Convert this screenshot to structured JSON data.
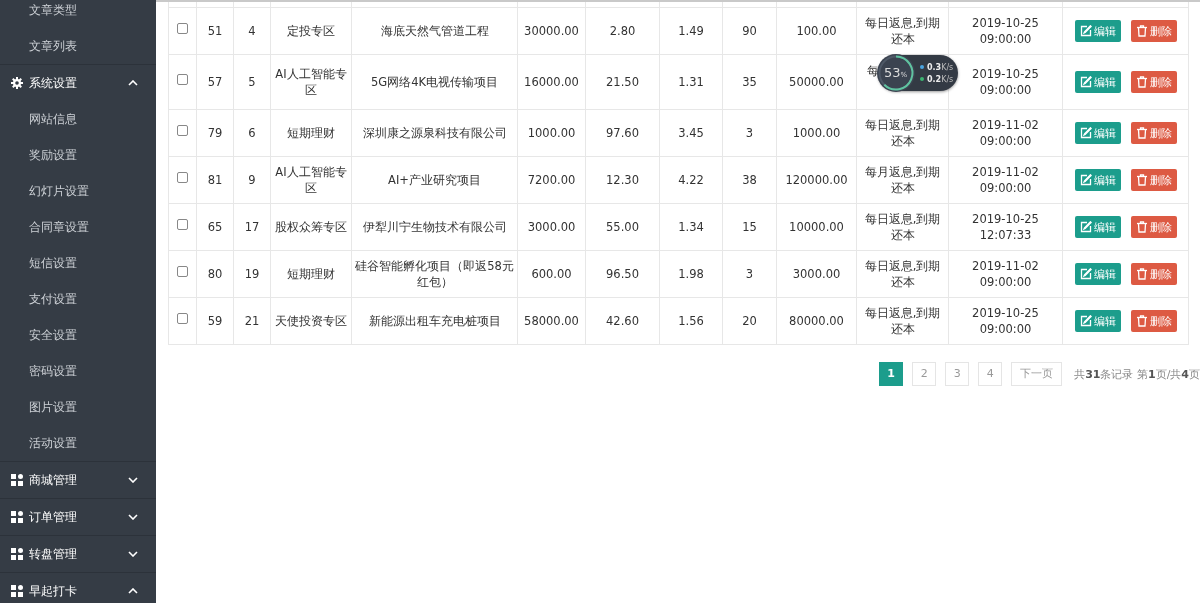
{
  "sidebar": {
    "items": [
      {
        "label": "文章类型"
      },
      {
        "label": "文章列表"
      }
    ],
    "groups": [
      {
        "label": "系统设置",
        "kind": "gear",
        "expanded": true,
        "children": [
          {
            "label": "网站信息"
          },
          {
            "label": "奖励设置"
          },
          {
            "label": "幻灯片设置"
          },
          {
            "label": "合同章设置"
          },
          {
            "label": "短信设置"
          },
          {
            "label": "支付设置"
          },
          {
            "label": "安全设置"
          },
          {
            "label": "密码设置"
          },
          {
            "label": "图片设置"
          },
          {
            "label": "活动设置"
          }
        ]
      },
      {
        "label": "商城管理",
        "kind": "grid",
        "expanded": false
      },
      {
        "label": "订单管理",
        "kind": "grid",
        "expanded": false
      },
      {
        "label": "转盘管理",
        "kind": "grid",
        "expanded": false
      },
      {
        "label": "早起打卡",
        "kind": "grid",
        "expanded": true
      }
    ]
  },
  "table": {
    "rows": [
      {
        "checked": false,
        "cells": [
          "51",
          "4",
          "定投专区",
          "海底天然气管道工程",
          "30000.00",
          "2.80",
          "1.49",
          "90",
          "100.00",
          "每日返息,到期还本",
          "2019-10-25 09:00:00"
        ],
        "actions": [
          {
            "label": "编辑",
            "kind": "edit"
          },
          {
            "label": "删除",
            "kind": "delete"
          }
        ]
      },
      {
        "checked": false,
        "cells": [
          "57",
          "5",
          "AI人工智能专区",
          "5G网络4K电视传输项目",
          "16000.00",
          "21.50",
          "1.31",
          "35",
          "50000.00",
          "每",
          "2019-10-25 09:00:00"
        ],
        "actions": [
          {
            "label": "编辑",
            "kind": "edit"
          },
          {
            "label": "删除",
            "kind": "delete"
          }
        ]
      },
      {
        "checked": false,
        "cells": [
          "79",
          "6",
          "短期理财",
          "深圳康之源泉科技有限公司",
          "1000.00",
          "97.60",
          "3.45",
          "3",
          "1000.00",
          "每日返息,到期还本",
          "2019-11-02 09:00:00"
        ],
        "actions": [
          {
            "label": "编辑",
            "kind": "edit"
          },
          {
            "label": "删除",
            "kind": "delete"
          }
        ]
      },
      {
        "checked": false,
        "cells": [
          "81",
          "9",
          "AI人工智能专区",
          "AI+产业研究项目",
          "7200.00",
          "12.30",
          "4.22",
          "38",
          "120000.00",
          "每月返息,到期还本",
          "2019-11-02 09:00:00"
        ],
        "actions": [
          {
            "label": "编辑",
            "kind": "edit"
          },
          {
            "label": "删除",
            "kind": "delete"
          }
        ]
      },
      {
        "checked": false,
        "cells": [
          "65",
          "17",
          "股权众筹专区",
          "伊犁川宁生物技术有限公司",
          "3000.00",
          "55.00",
          "1.34",
          "15",
          "10000.00",
          "每日返息,到期还本",
          "2019-10-25 12:07:33"
        ],
        "actions": [
          {
            "label": "编辑",
            "kind": "edit"
          },
          {
            "label": "删除",
            "kind": "delete"
          }
        ]
      },
      {
        "checked": false,
        "cells": [
          "80",
          "19",
          "短期理财",
          "硅谷智能孵化项目（即返58元红包）",
          "600.00",
          "96.50",
          "1.98",
          "3",
          "3000.00",
          "每日返息,到期还本",
          "2019-11-02 09:00:00"
        ],
        "actions": [
          {
            "label": "编辑",
            "kind": "edit"
          },
          {
            "label": "删除",
            "kind": "delete"
          }
        ]
      },
      {
        "checked": false,
        "cells": [
          "59",
          "21",
          "天使投资专区",
          "新能源出租车充电桩项目",
          "58000.00",
          "42.60",
          "1.56",
          "20",
          "80000.00",
          "每日返息,到期还本",
          "2019-10-25 09:00:00"
        ],
        "actions": [
          {
            "label": "编辑",
            "kind": "edit"
          },
          {
            "label": "删除",
            "kind": "delete"
          }
        ]
      }
    ]
  },
  "pagination": {
    "pages": [
      {
        "label": "1",
        "selected": true
      },
      {
        "label": "2",
        "selected": false
      },
      {
        "label": "3",
        "selected": false
      },
      {
        "label": "4",
        "selected": false
      }
    ],
    "next": "下一页",
    "summary": "共**31**条记录 第**1**页/共**4**页"
  },
  "speed_widget": {
    "percent": "53",
    "percent_unit": "%",
    "upload": "0.3",
    "upload_unit": "K/s",
    "download": "0.2",
    "download_unit": "K/s"
  }
}
